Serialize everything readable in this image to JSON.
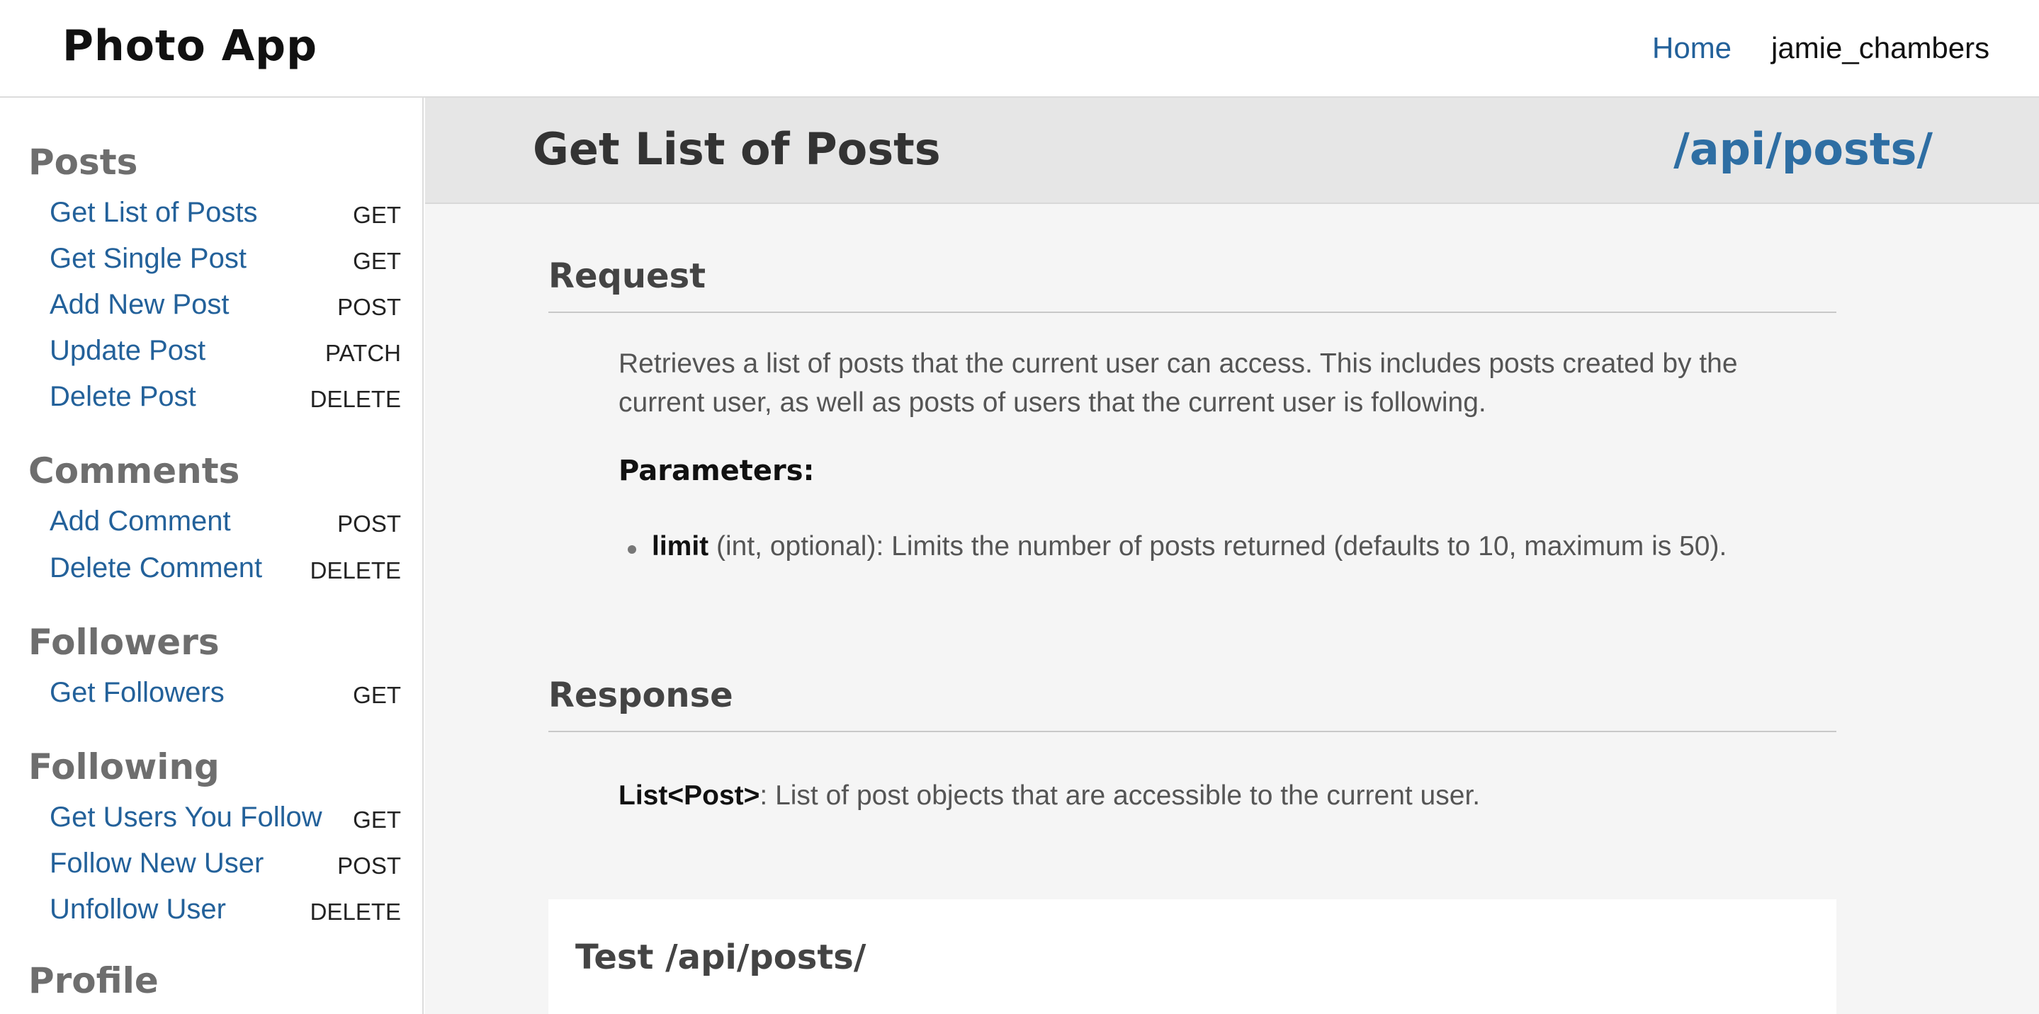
{
  "header": {
    "brand": "Photo App",
    "nav_home": "Home",
    "nav_user": "jamie_chambers"
  },
  "sidebar": {
    "sections": [
      {
        "title": "Posts",
        "items": [
          {
            "label": "Get List of Posts",
            "method": "GET"
          },
          {
            "label": "Get Single Post",
            "method": "GET"
          },
          {
            "label": "Add New Post",
            "method": "POST"
          },
          {
            "label": "Update Post",
            "method": "PATCH"
          },
          {
            "label": "Delete Post",
            "method": "DELETE"
          }
        ]
      },
      {
        "title": "Comments",
        "items": [
          {
            "label": "Add Comment",
            "method": "POST"
          },
          {
            "label": "Delete Comment",
            "method": "DELETE"
          }
        ]
      },
      {
        "title": "Followers",
        "items": [
          {
            "label": "Get Followers",
            "method": "GET"
          }
        ]
      },
      {
        "title": "Following",
        "items": [
          {
            "label": "Get Users You Follow",
            "method": "GET"
          },
          {
            "label": "Follow New User",
            "method": "POST"
          },
          {
            "label": "Unfollow User",
            "method": "DELETE"
          }
        ]
      },
      {
        "title": "Profile",
        "items": []
      }
    ]
  },
  "main": {
    "title": "Get List of Posts",
    "endpoint": "/api/posts/",
    "request": {
      "heading": "Request",
      "description": "Retrieves a list of posts that the current user can access. This includes posts created by the current user, as well as posts of users that the current user is following.",
      "params_label": "Parameters:",
      "params": [
        {
          "name": "limit",
          "detail": " (int, optional): Limits the number of posts returned (defaults to 10, maximum is 50)."
        }
      ]
    },
    "response": {
      "heading": "Response",
      "type": "List<Post>",
      "detail": ": List of post objects that are accessible to the current user."
    },
    "test": {
      "title": "Test /api/posts/"
    }
  },
  "colors": {
    "link": "#23619a",
    "endpoint": "#2e6ea3",
    "banner_bg": "#e6e6e6",
    "main_bg": "#f5f5f5"
  }
}
